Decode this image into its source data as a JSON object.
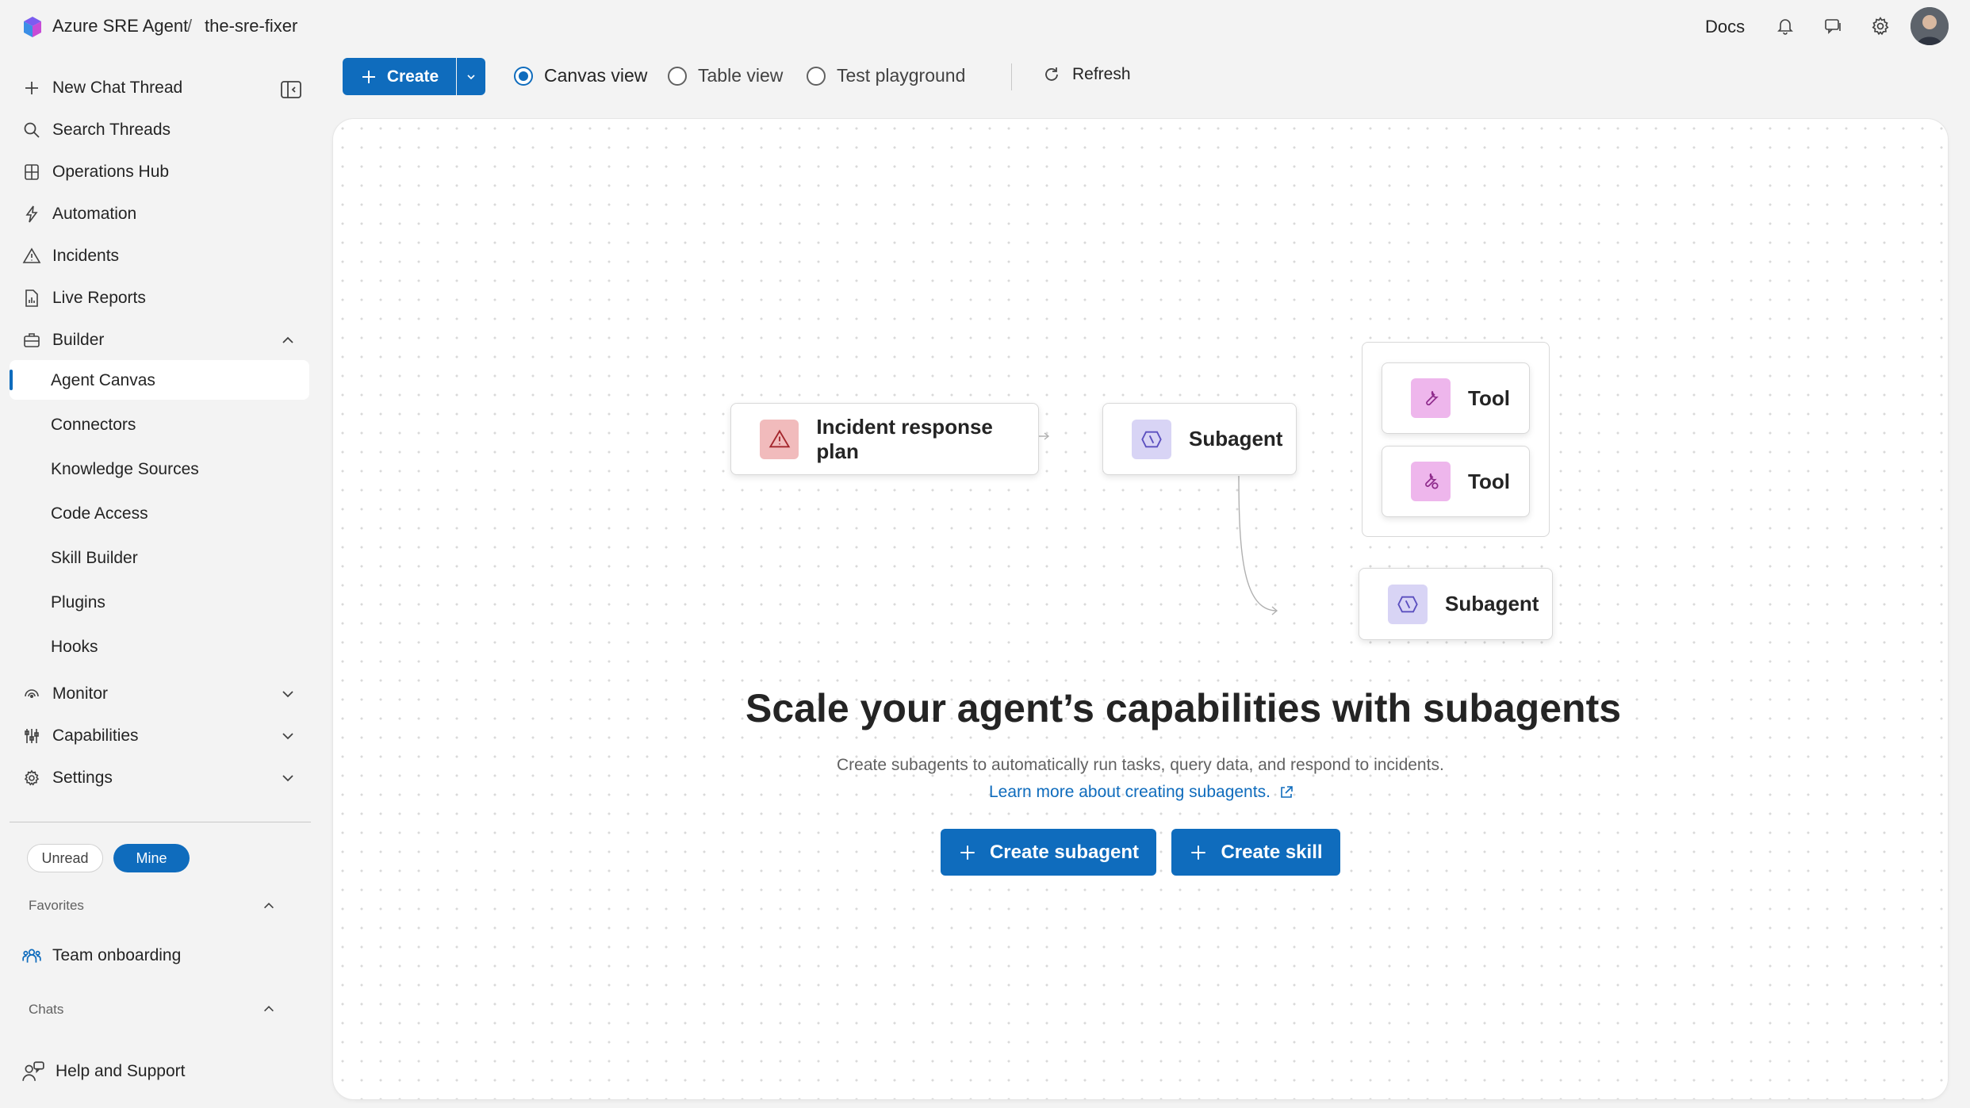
{
  "header": {
    "app_name": "Azure SRE Agent",
    "separator": "/",
    "agent_name": "the-sre-fixer",
    "docs_label": "Docs"
  },
  "sidebar": {
    "items": [
      {
        "label": "New Chat Thread",
        "icon": "plus-icon"
      },
      {
        "label": "Search Threads",
        "icon": "search-icon"
      },
      {
        "label": "Operations Hub",
        "icon": "book-icon"
      },
      {
        "label": "Automation",
        "icon": "flash-icon"
      },
      {
        "label": "Incidents",
        "icon": "warning-icon"
      },
      {
        "label": "Live Reports",
        "icon": "report-icon"
      },
      {
        "label": "Builder",
        "icon": "toolbox-icon"
      }
    ],
    "builder_items": [
      {
        "label": "Agent Canvas",
        "active": true
      },
      {
        "label": "Connectors"
      },
      {
        "label": "Knowledge Sources"
      },
      {
        "label": "Code Access"
      },
      {
        "label": "Skill Builder"
      },
      {
        "label": "Plugins"
      },
      {
        "label": "Hooks"
      }
    ],
    "lower_items": [
      {
        "label": "Monitor",
        "icon": "monitor-icon"
      },
      {
        "label": "Capabilities",
        "icon": "capabilities-icon"
      },
      {
        "label": "Settings",
        "icon": "gear-icon"
      }
    ],
    "filters": {
      "unread": "Unread",
      "mine": "Mine"
    },
    "favorites_label": "Favorites",
    "favorites": [
      {
        "label": "Team onboarding",
        "icon": "people-icon"
      }
    ],
    "chats_label": "Chats",
    "help_label": "Help and Support"
  },
  "toolbar": {
    "create_label": "Create",
    "views": [
      {
        "label": "Canvas view",
        "checked": true
      },
      {
        "label": "Table view",
        "checked": false
      },
      {
        "label": "Test playground",
        "checked": false
      }
    ],
    "refresh_label": "Refresh"
  },
  "canvas": {
    "nodes": {
      "incident": "Incident response plan",
      "subagent_1": "Subagent",
      "tool_1": "Tool",
      "tool_2": "Tool",
      "subagent_2": "Subagent"
    },
    "headline": "Scale your agent’s capabilities with subagents",
    "subtext": "Create subagents to automatically run tasks, query data, and respond to incidents.",
    "learn_more": "Learn more about creating subagents.",
    "create_subagent": "Create subagent",
    "create_skill": "Create skill"
  },
  "colors": {
    "accent": "#0f6cbd",
    "incident_icon_bg": "#f1bbbc",
    "subagent_icon_bg": "#d8d4f5",
    "tool_icon_bg": "#eeb6ec"
  }
}
